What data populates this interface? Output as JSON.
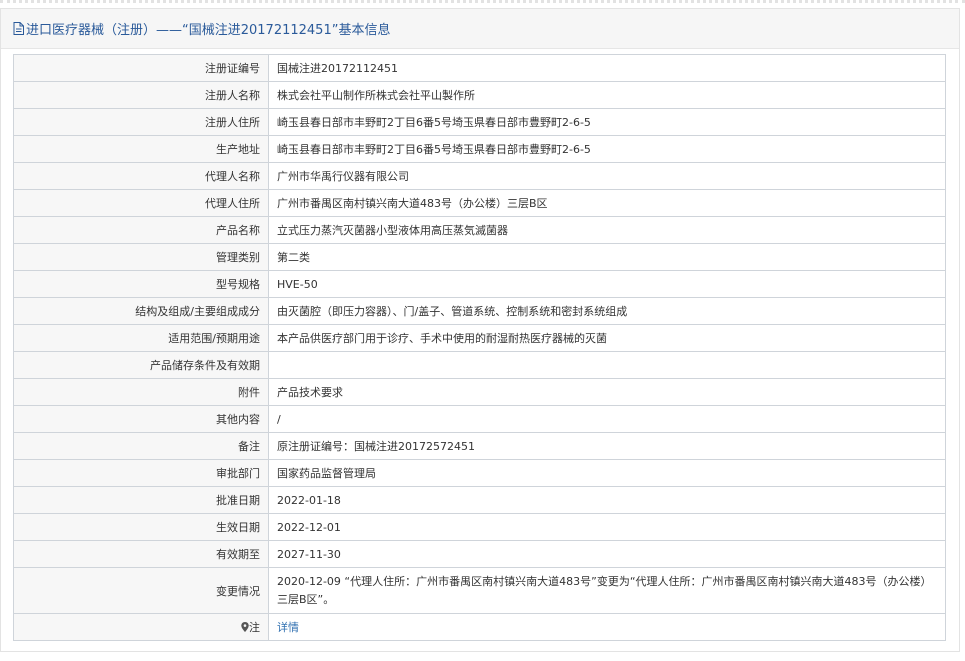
{
  "page": {
    "title": "进口医疗器械（注册）——“国械注进20172112451”基本信息"
  },
  "rows": [
    {
      "label": "注册证编号",
      "value": "国械注进20172112451"
    },
    {
      "label": "注册人名称",
      "value": "株式会社平山制作所株式会社平山製作所"
    },
    {
      "label": "注册人住所",
      "value": "崎玉县春日部市丰野町2丁目6番5号埼玉県春日部市豊野町2-6-5"
    },
    {
      "label": "生产地址",
      "value": "崎玉县春日部市丰野町2丁目6番5号埼玉県春日部市豊野町2-6-5"
    },
    {
      "label": "代理人名称",
      "value": "广州市华禹行仪器有限公司"
    },
    {
      "label": "代理人住所",
      "value": "广州市番禺区南村镇兴南大道483号（办公楼）三层B区"
    },
    {
      "label": "产品名称",
      "value": "立式压力蒸汽灭菌器小型液体用高压蒸気滅菌器"
    },
    {
      "label": "管理类别",
      "value": "第二类"
    },
    {
      "label": "型号规格",
      "value": "HVE-50"
    },
    {
      "label": "结构及组成/主要组成成分",
      "value": "由灭菌腔（即压力容器）、门/盖子、管道系统、控制系统和密封系统组成"
    },
    {
      "label": "适用范围/预期用途",
      "value": "本产品供医疗部门用于诊疗、手术中使用的耐湿耐热医疗器械的灭菌"
    },
    {
      "label": "产品储存条件及有效期",
      "value": ""
    },
    {
      "label": "附件",
      "value": "产品技术要求"
    },
    {
      "label": "其他内容",
      "value": "/"
    },
    {
      "label": "备注",
      "value": "原注册证编号：国械注进20172572451"
    },
    {
      "label": "审批部门",
      "value": "国家药品监督管理局"
    },
    {
      "label": "批准日期",
      "value": "2022-01-18"
    },
    {
      "label": "生效日期",
      "value": "2022-12-01"
    },
    {
      "label": "有效期至",
      "value": "2027-11-30"
    },
    {
      "label": "变更情况",
      "value": "2020-12-09 “代理人住所：广州市番禺区南村镇兴南大道483号”变更为“代理人住所：广州市番禺区南村镇兴南大道483号（办公楼）三层B区”。"
    }
  ],
  "note_row": {
    "label": "注",
    "link_text": "详情",
    "icon": "location-pin-icon"
  },
  "colors": {
    "header_text": "#2a5a9a",
    "link": "#2f6fb0",
    "label_bg": "#f7f7f7",
    "border": "#cfd4da"
  }
}
